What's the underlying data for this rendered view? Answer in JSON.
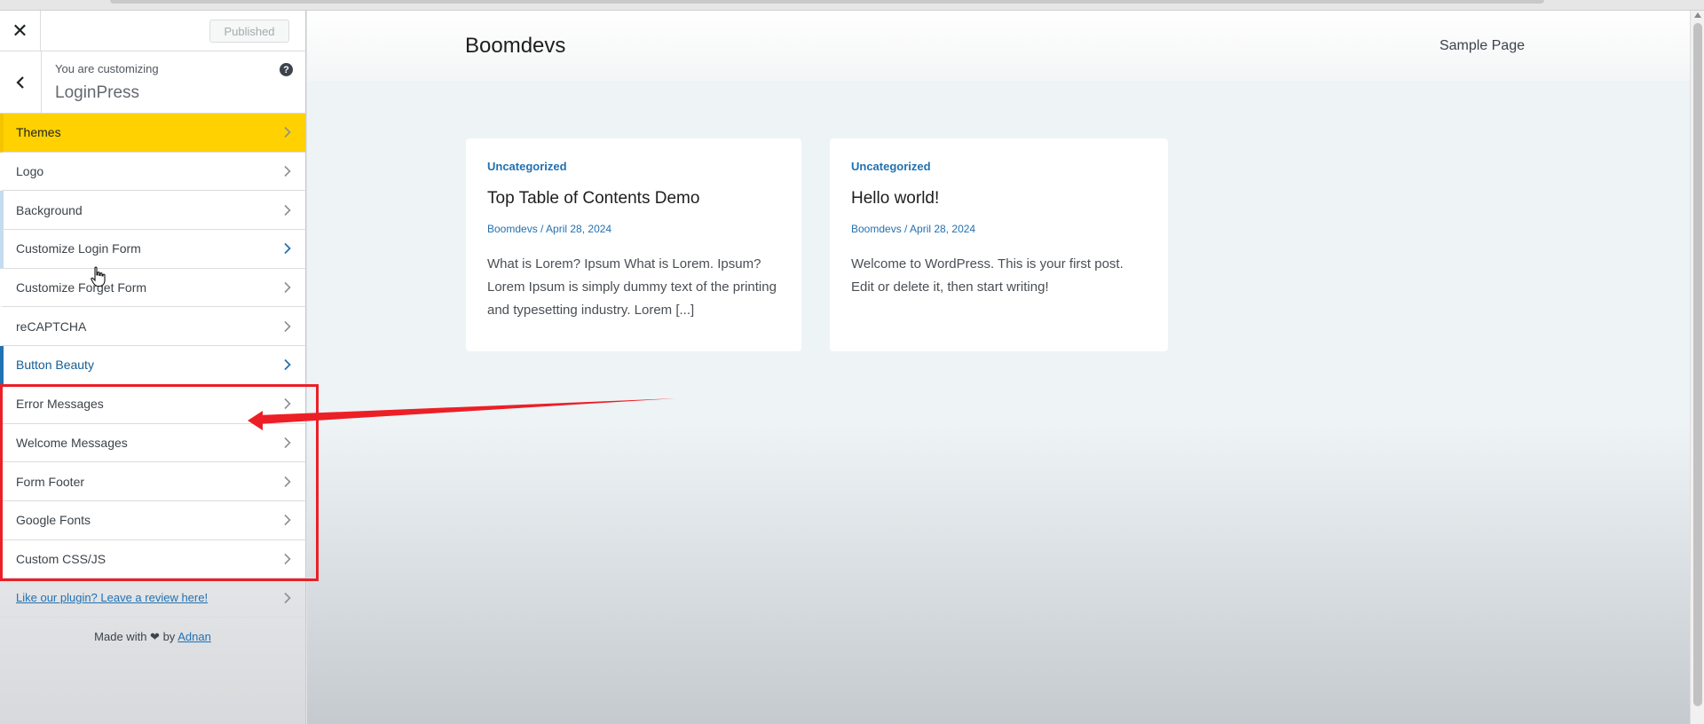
{
  "sidebar": {
    "close_icon": "close-icon",
    "published_label": "Published",
    "info_prefix": "You are customizing",
    "info_title": "LoginPress",
    "help_glyph": "?",
    "items": [
      {
        "label": "Themes"
      },
      {
        "label": "Logo"
      },
      {
        "label": "Background"
      },
      {
        "label": "Customize Login Form"
      },
      {
        "label": "Customize Forget Form"
      },
      {
        "label": "reCAPTCHA"
      },
      {
        "label": "Button Beauty"
      },
      {
        "label": "Error Messages"
      },
      {
        "label": "Welcome Messages"
      },
      {
        "label": "Form Footer"
      },
      {
        "label": "Google Fonts"
      },
      {
        "label": "Custom CSS/JS"
      }
    ],
    "review_link": "Like our plugin? Leave a review here!",
    "made_with_prefix": "Made with",
    "made_with_by": "by",
    "made_with_author": "Adnan"
  },
  "preview": {
    "site_title": "Boomdevs",
    "nav_link": "Sample Page",
    "posts": [
      {
        "category": "Uncategorized",
        "title": "Top Table of Contents Demo",
        "meta": "Boomdevs / April 28, 2024",
        "excerpt": "What is Lorem? Ipsum What is Lorem. Ipsum? Lorem Ipsum is simply dummy text of the printing and typesetting industry. Lorem [...]"
      },
      {
        "category": "Uncategorized",
        "title": "Hello world!",
        "meta": "Boomdevs / April 28, 2024",
        "excerpt": "Welcome to WordPress. This is your first post. Edit or delete it, then start writing!"
      }
    ]
  },
  "colors": {
    "accent": "#2271b1",
    "active_item": "#ffd100",
    "annotation": "#ec1f26"
  }
}
